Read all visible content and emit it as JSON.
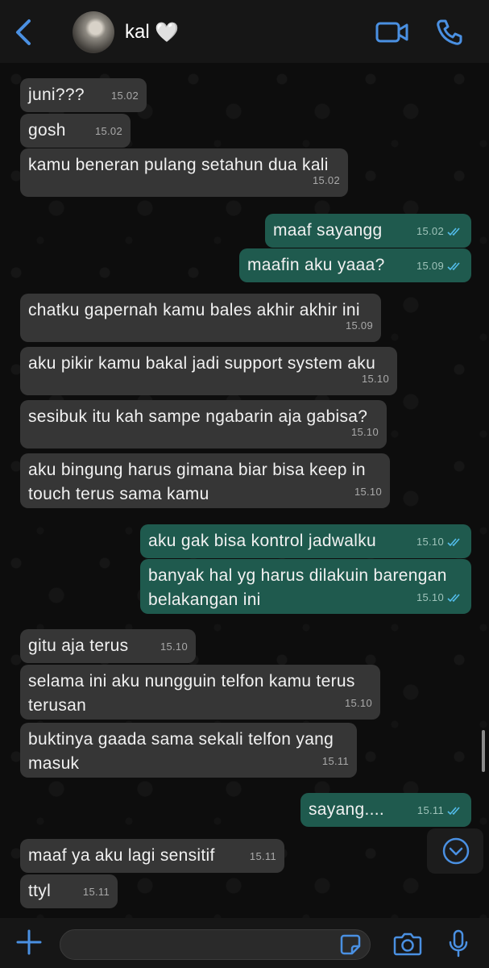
{
  "header": {
    "contact_name": "kal",
    "heart": "🤍"
  },
  "messages": [
    {
      "dir": "in",
      "text": "juni???",
      "time": "15.02"
    },
    {
      "dir": "in",
      "text": "gosh",
      "time": "15.02"
    },
    {
      "dir": "in",
      "text": "kamu beneran pulang setahun dua kali",
      "time": "15.02"
    },
    {
      "dir": "out",
      "text": "maaf sayangg",
      "time": "15.02"
    },
    {
      "dir": "out",
      "text": "maafin aku yaaa?",
      "time": "15.09"
    },
    {
      "dir": "in",
      "text": "chatku gapernah kamu bales akhir akhir ini",
      "time": "15.09"
    },
    {
      "dir": "in",
      "text": "aku pikir kamu bakal jadi support system aku",
      "time": "15.10"
    },
    {
      "dir": "in",
      "text": "sesibuk itu kah sampe ngabarin aja gabisa?",
      "time": "15.10"
    },
    {
      "dir": "in",
      "text": "aku bingung harus gimana biar bisa keep in\ntouch terus sama kamu",
      "time": "15.10"
    },
    {
      "dir": "out",
      "text": "aku gak bisa kontrol jadwalku",
      "time": "15.10"
    },
    {
      "dir": "out",
      "text": "banyak hal yg harus dilakuin barengan\nbelakangan ini",
      "time": "15.10"
    },
    {
      "dir": "in",
      "text": "gitu aja terus",
      "time": "15.10"
    },
    {
      "dir": "in",
      "text": "selama ini aku nungguin telfon kamu terus\nterusan",
      "time": "15.10"
    },
    {
      "dir": "in",
      "text": "buktinya gaada sama sekali telfon yang\nmasuk",
      "time": "15.11"
    },
    {
      "dir": "out",
      "text": "sayang....",
      "time": "15.11"
    },
    {
      "dir": "in",
      "text": "maaf ya aku lagi sensitif",
      "time": "15.11"
    },
    {
      "dir": "in",
      "text": "ttyl",
      "time": "15.11"
    }
  ],
  "colors": {
    "incoming_bubble": "#363636",
    "outgoing_bubble": "#1f5a4e",
    "accent": "#4a90e2",
    "read_ticks": "#53bdeb"
  },
  "input": {
    "value": "",
    "placeholder": ""
  },
  "icons": {
    "back": "chevron-left-icon",
    "video": "video-camera-icon",
    "phone": "phone-icon",
    "plus": "plus-icon",
    "sticker": "sticker-icon",
    "camera": "camera-icon",
    "mic": "microphone-icon",
    "scroll": "chevron-down-icon",
    "ticks": "double-check-icon"
  }
}
